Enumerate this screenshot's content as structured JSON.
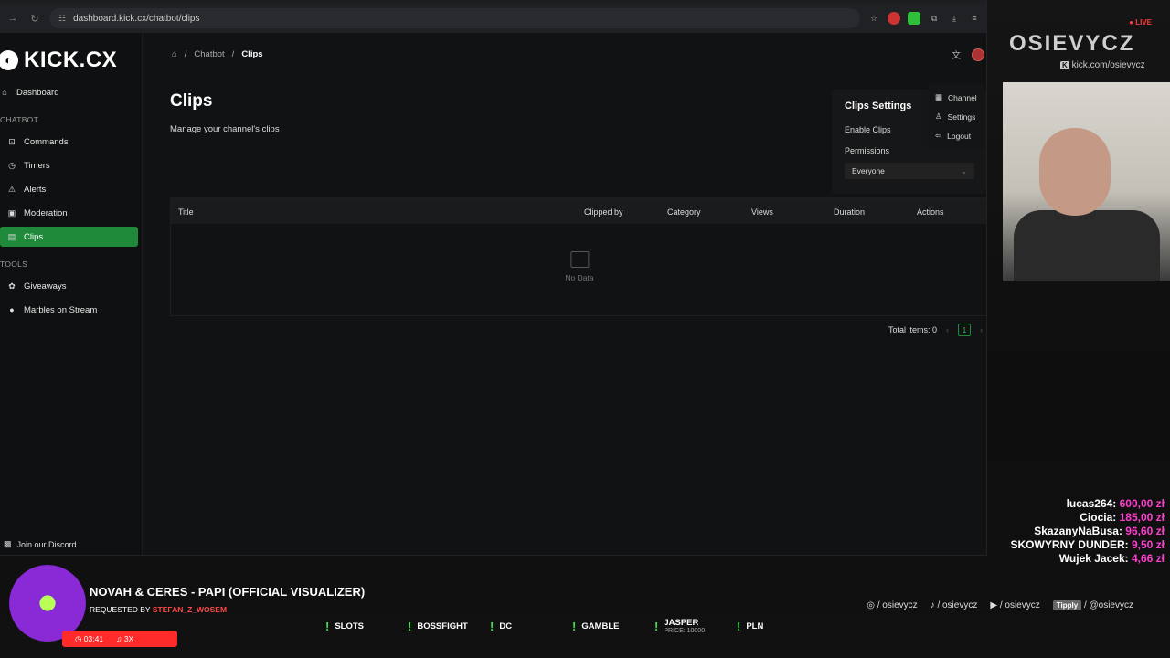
{
  "browser": {
    "url": "dashboard.kick.cx/chatbot/clips"
  },
  "app": {
    "logo_text": "KICK.CX",
    "nav": {
      "dashboard": "Dashboard",
      "section_chatbot": "CHATBOT",
      "commands": "Commands",
      "timers": "Timers",
      "alerts": "Alerts",
      "moderation": "Moderation",
      "clips": "Clips",
      "section_tools": "TOOLS",
      "giveaways": "Giveaways",
      "marbles": "Marbles on Stream"
    },
    "discord_link": "Join our Discord",
    "breadcrumb": {
      "level1": "Chatbot",
      "level2": "Clips",
      "sep": "/"
    },
    "title": "Clips",
    "subtitle": "Manage your channel's clips",
    "settings_card": {
      "title": "Clips Settings",
      "enable_label": "Enable Clips",
      "enabled": false,
      "permissions_label": "Permissions",
      "permissions_value": "Everyone"
    },
    "table": {
      "columns": [
        "Title",
        "Clipped by",
        "Category",
        "Views",
        "Duration",
        "Actions"
      ],
      "empty_text": "No Data"
    },
    "pagination": {
      "total": "Total items: 0",
      "page": "1"
    },
    "user_menu": [
      "Channel",
      "Settings",
      "Logout"
    ]
  },
  "overlay": {
    "live_badge": "LIVE",
    "channel_name": "OSIEVYCZ",
    "channel_url": "kick.com/osievycz",
    "donations": [
      {
        "name": "lucas264:",
        "amount": "600,00 zł"
      },
      {
        "name": "Ciocia:",
        "amount": "185,00 zł"
      },
      {
        "name": "SkazanyNaBusa:",
        "amount": "96,60 zł"
      },
      {
        "name": "SKOWYRNY DUNDER:",
        "amount": "9,50 zł"
      },
      {
        "name": "Wujek Jacek:",
        "amount": "4,66 zł"
      }
    ],
    "now_playing": {
      "title": "NOVAH & CERES - PAPI (OFFICIAL VISUALIZER)",
      "requested_label": "REQUESTED BY",
      "requested_by": "STEFAN_Z_WOSEM",
      "time": "03:41",
      "count": "3X"
    },
    "commands": [
      {
        "label": "SLOTS"
      },
      {
        "label": "BOSSFIGHT"
      },
      {
        "label": "DC"
      },
      {
        "label": "GAMBLE"
      },
      {
        "label": "JASPER",
        "sub": "PRICE: 10000"
      },
      {
        "label": "PLN"
      }
    ],
    "socials": [
      "/ osievycz",
      "/ osievycz",
      "/ osievycz",
      "/ @osievycz"
    ],
    "tippy_label": "Tipply"
  }
}
